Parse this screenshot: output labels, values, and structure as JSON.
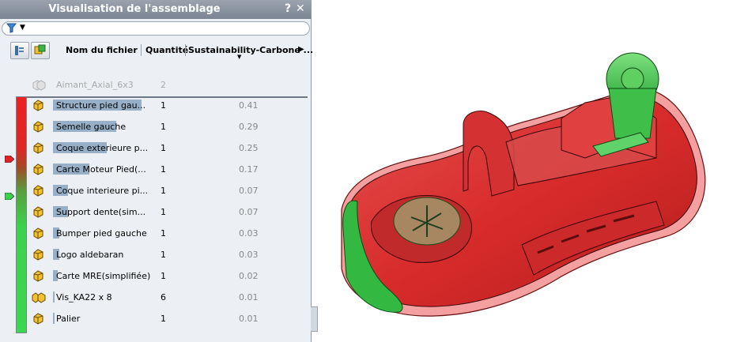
{
  "panel": {
    "title": "Visualisation de l'assemblage",
    "help_label": "?",
    "close_label": "✕"
  },
  "columns": {
    "name": "Nom du fichier",
    "quantity": "Quantité",
    "sustainability": "Sustainability-Carbone ..."
  },
  "top_item": {
    "name": "Aimant_Axial_6x3",
    "quantity": "2"
  },
  "rows": [
    {
      "name": "Structure pied gau...",
      "quantity": "1",
      "value": "0.41",
      "bar": 1.0
    },
    {
      "name": "Semelle gauche",
      "quantity": "1",
      "value": "0.29",
      "bar": 0.71
    },
    {
      "name": "Coque exterieure p...",
      "quantity": "1",
      "value": "0.25",
      "bar": 0.61
    },
    {
      "name": "Carte Moteur Pied(...",
      "quantity": "1",
      "value": "0.17",
      "bar": 0.41
    },
    {
      "name": "Coque interieure pi...",
      "quantity": "1",
      "value": "0.07",
      "bar": 0.17
    },
    {
      "name": "Support dente(sim...",
      "quantity": "1",
      "value": "0.07",
      "bar": 0.17
    },
    {
      "name": "Bumper pied gauche",
      "quantity": "1",
      "value": "0.03",
      "bar": 0.07
    },
    {
      "name": "Logo aldebaran",
      "quantity": "1",
      "value": "0.03",
      "bar": 0.07
    },
    {
      "name": "Carte MRE(simplifiée)",
      "quantity": "1",
      "value": "0.02",
      "bar": 0.05
    },
    {
      "name": "Vis_KA22 x 8",
      "quantity": "6",
      "value": "0.01",
      "bar": 0.02
    },
    {
      "name": "Palier",
      "quantity": "1",
      "value": "0.01",
      "bar": 0.02
    }
  ],
  "icons": {
    "filter": "filter-icon",
    "part": "part-icon",
    "assembly": "assembly-icon"
  },
  "colors": {
    "high": "#e22222",
    "low": "#38d24a",
    "name_bar": "#97b0c8"
  }
}
